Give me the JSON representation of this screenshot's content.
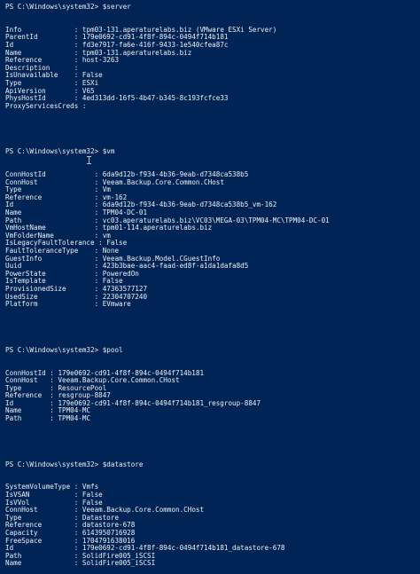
{
  "sections": [
    {
      "prompt": "PS C:\\Windows\\system32> $server",
      "key_width": 16,
      "rows": [
        {
          "k": "Info",
          "v": "tpm03-131.aperaturelabs.biz (VMware ESXi Server)"
        },
        {
          "k": "ParentId",
          "v": "179e0692-cd91-4f8f-894c-0494f714b181"
        },
        {
          "k": "Id",
          "v": "fd3e7917-fa6e-416f-9433-1e540cfea87c"
        },
        {
          "k": "Name",
          "v": "tpm03-131.aperaturelabs.biz"
        },
        {
          "k": "Reference",
          "v": "host-3263"
        },
        {
          "k": "Description",
          "v": ""
        },
        {
          "k": "IsUnavailable",
          "v": "False"
        },
        {
          "k": "Type",
          "v": "ESXi"
        },
        {
          "k": "ApiVersion",
          "v": "V65"
        },
        {
          "k": "PhysHostId",
          "v": "4ed313dd-16f5-4b47-b345-8c193fcfce33"
        },
        {
          "k": "ProxyServicesCreds",
          "v": ""
        }
      ]
    },
    {
      "prompt": "PS C:\\Windows\\system32> $vm",
      "key_width": 21,
      "rows": [
        {
          "k": "ConnHostId",
          "v": "6da9d12b-f934-4b36-9eab-d7348ca538b5"
        },
        {
          "k": "ConnHost",
          "v": "Veeam.Backup.Core.Common.CHost"
        },
        {
          "k": "Type",
          "v": "Vm"
        },
        {
          "k": "Reference",
          "v": "vm-162"
        },
        {
          "k": "Id",
          "v": "6da9d12b-f934-4b36-9eab-d7348ca538b5_vm-162"
        },
        {
          "k": "Name",
          "v": "TPM04-DC-01"
        },
        {
          "k": "Path",
          "v": "vc03.aperaturelabs.biz\\VC03\\MEGA-03\\TPM04-MC\\TPM04-DC-01"
        },
        {
          "k": "VmHostName",
          "v": "tpm01-114.aperaturelabs.biz"
        },
        {
          "k": "VmFolderName",
          "v": "vm"
        },
        {
          "k": "IsLegacyFaultTolerance",
          "v": "False"
        },
        {
          "k": "FaultToleranceType",
          "v": "None"
        },
        {
          "k": "GuestInfo",
          "v": "Veeam.Backup.Model.CGuestInfo"
        },
        {
          "k": "Uuid",
          "v": "423b3bae-aac4-faad-ed8f-a1da1dafa8d5"
        },
        {
          "k": "PowerState",
          "v": "PoweredOn"
        },
        {
          "k": "IsTemplate",
          "v": "False"
        },
        {
          "k": "ProvisionedSize",
          "v": "47363577127"
        },
        {
          "k": "UsedSize",
          "v": "22304707240"
        },
        {
          "k": "Platform",
          "v": "EVmware"
        }
      ]
    },
    {
      "prompt": "PS C:\\Windows\\system32> $pool",
      "key_width": 10,
      "rows": [
        {
          "k": "ConnHostId",
          "v": "179e0692-cd91-4f8f-894c-0494f714b181"
        },
        {
          "k": "ConnHost",
          "v": "Veeam.Backup.Core.Common.CHost"
        },
        {
          "k": "Type",
          "v": "ResourcePool"
        },
        {
          "k": "Reference",
          "v": "resgroup-8847"
        },
        {
          "k": "Id",
          "v": "179e0692-cd91-4f8f-894c-0494f714b181_resgroup-8847"
        },
        {
          "k": "Name",
          "v": "TPM04-MC"
        },
        {
          "k": "Path",
          "v": "TPM04-MC"
        }
      ]
    },
    {
      "prompt": "PS C:\\Windows\\system32> $datastore",
      "key_width": 16,
      "rows": [
        {
          "k": "SystemVolumeType",
          "v": "Vmfs"
        },
        {
          "k": "IsVSAN",
          "v": "False"
        },
        {
          "k": "IsVVol",
          "v": "False"
        },
        {
          "k": "ConnHost",
          "v": "Veeam.Backup.Core.Common.CHost"
        },
        {
          "k": "Type",
          "v": "Datastore"
        },
        {
          "k": "Reference",
          "v": "datastore-678"
        },
        {
          "k": "Capacity",
          "v": "6143950716928"
        },
        {
          "k": "FreeSpace",
          "v": "1704791638016"
        },
        {
          "k": "Id",
          "v": "179e0692-cd91-4f8f-894c-0494f714b181_datastore-678"
        },
        {
          "k": "Path",
          "v": "SolidFire005_iSCSI"
        },
        {
          "k": "Name",
          "v": "SolidFire005_iSCSI"
        }
      ]
    }
  ]
}
